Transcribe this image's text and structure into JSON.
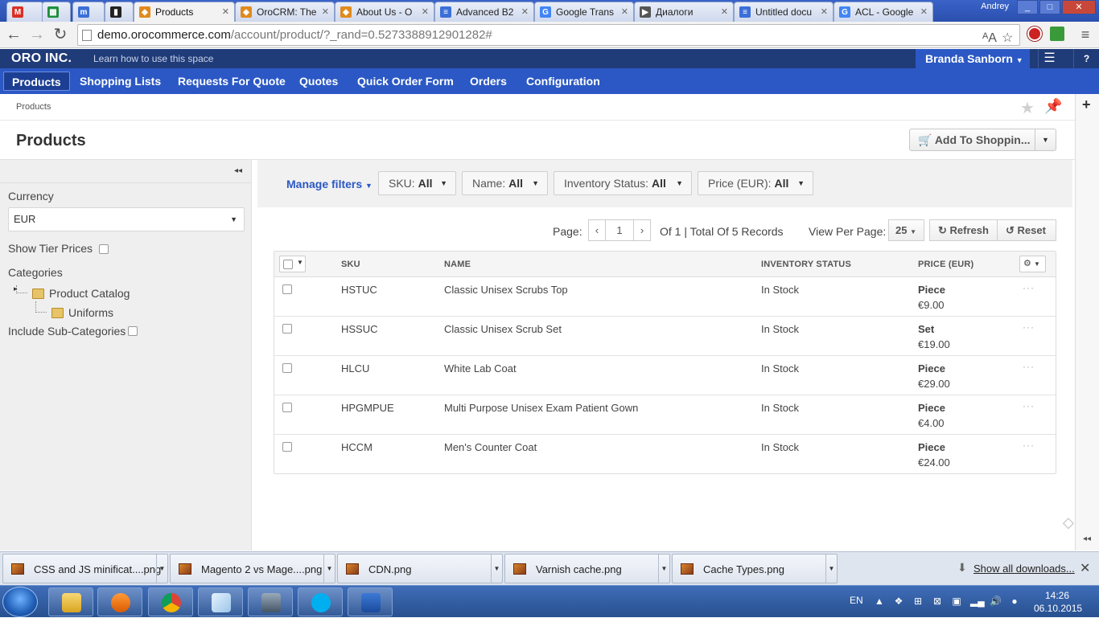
{
  "browser": {
    "tabs": [
      {
        "title": "",
        "icon": "gmail-icon"
      },
      {
        "title": "",
        "icon": "sheets-icon"
      },
      {
        "title": "",
        "icon": "m-icon"
      },
      {
        "title": "",
        "icon": "trello-icon"
      },
      {
        "title": "Products",
        "icon": "oro-icon",
        "active": true
      },
      {
        "title": "OroCRM: The",
        "icon": "oro-icon"
      },
      {
        "title": "About Us - O",
        "icon": "oro-icon"
      },
      {
        "title": "Advanced B2",
        "icon": "docs-icon"
      },
      {
        "title": "Google Trans",
        "icon": "google-icon"
      },
      {
        "title": "Диалоги",
        "icon": "play-icon"
      },
      {
        "title": "Untitled docu",
        "icon": "docs-icon"
      },
      {
        "title": "ACL - Google",
        "icon": "google-icon"
      }
    ],
    "os_user": "Andrey",
    "url_host": "demo.orocommerce.com",
    "url_path": "/account/product/?_rand=0.5273388912901282#"
  },
  "app": {
    "brand": "ORO INC.",
    "learn_link": "Learn how to use this space",
    "user_name": "Branda Sanborn",
    "nav": [
      "Products",
      "Shopping Lists",
      "Requests For Quote",
      "Quotes",
      "Quick Order Form",
      "Orders",
      "Configuration"
    ],
    "active_nav": "Products",
    "breadcrumb": "Products",
    "page_title": "Products",
    "add_button": "Add To Shoppin..."
  },
  "sidebar": {
    "currency_label": "Currency",
    "currency_value": "EUR",
    "show_tier_prices": "Show Tier Prices",
    "categories_label": "Categories",
    "tree": [
      "Product Catalog",
      "Uniforms"
    ],
    "include_sub": "Include Sub-Categories"
  },
  "filters": {
    "manage": "Manage filters",
    "items": [
      {
        "label": "SKU:",
        "value": "All"
      },
      {
        "label": "Name:",
        "value": "All"
      },
      {
        "label": "Inventory Status:",
        "value": "All"
      },
      {
        "label": "Price (EUR):",
        "value": "All"
      }
    ]
  },
  "pager": {
    "page_label": "Page:",
    "page": "1",
    "total": "Of 1 | Total Of 5 Records",
    "per_page_label": "View Per Page:",
    "per_page": "25",
    "refresh": "Refresh",
    "reset": "Reset"
  },
  "grid": {
    "columns": [
      "SKU",
      "NAME",
      "INVENTORY STATUS",
      "PRICE (EUR)"
    ],
    "rows": [
      {
        "sku": "HSTUC",
        "name": "Classic Unisex Scrubs Top",
        "status": "In Stock",
        "unit": "Piece",
        "price": "€9.00"
      },
      {
        "sku": "HSSUC",
        "name": "Classic Unisex Scrub Set",
        "status": "In Stock",
        "unit": "Set",
        "price": "€19.00"
      },
      {
        "sku": "HLCU",
        "name": "White Lab Coat",
        "status": "In Stock",
        "unit": "Piece",
        "price": "€29.00"
      },
      {
        "sku": "HPGMPUE",
        "name": "Multi Purpose Unisex Exam Patient Gown",
        "status": "In Stock",
        "unit": "Piece",
        "price": "€4.00"
      },
      {
        "sku": "HCCM",
        "name": "Men's Counter Coat",
        "status": "In Stock",
        "unit": "Piece",
        "price": "€24.00"
      }
    ]
  },
  "downloads": {
    "items": [
      "CSS and JS minificat....png",
      "Magento 2 vs Mage....png",
      "CDN.png",
      "Varnish cache.png",
      "Cache Types.png"
    ],
    "show_all": "Show all downloads..."
  },
  "taskbar": {
    "lang": "EN",
    "time": "14:26",
    "date": "06.10.2015"
  },
  "colors": {
    "header_dark": "#1f3b78",
    "nav_blue": "#2b58c4",
    "link_blue": "#2b58c4"
  }
}
